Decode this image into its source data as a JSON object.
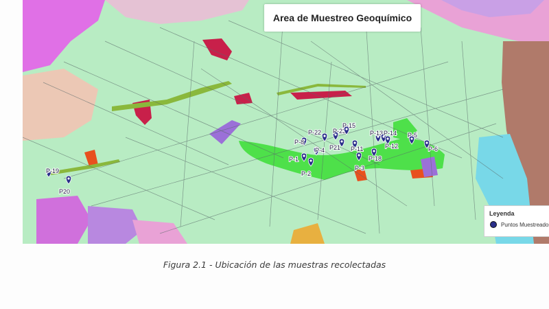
{
  "map": {
    "title": "Area de Muestreo Geoquímico",
    "legend": {
      "title": "Leyenda",
      "items": [
        {
          "label": "Puntos Muestreados",
          "color": "#2a2f8a"
        }
      ]
    },
    "samples": [
      {
        "id": "P-19"
      },
      {
        "id": "P20"
      },
      {
        "id": "P-1"
      },
      {
        "id": "P-2"
      },
      {
        "id": "P-4"
      },
      {
        "id": "P-8"
      },
      {
        "id": "P-22"
      },
      {
        "id": "P-23"
      },
      {
        "id": "P-15"
      },
      {
        "id": "P21"
      },
      {
        "id": "P-11"
      },
      {
        "id": "P-13"
      },
      {
        "id": "P-14"
      },
      {
        "id": "P-3"
      },
      {
        "id": "P-18"
      },
      {
        "id": "P-12"
      },
      {
        "id": "P-5"
      },
      {
        "id": "P-6"
      }
    ],
    "colors": {
      "base": "#b8ecc3",
      "magenta": "#e070e6",
      "bright_green": "#4ee04a",
      "crimson": "#c8204a",
      "orange": "#e8501e",
      "purple": "#9b70d8",
      "cyan": "#78d8e8",
      "brown": "#b07a6a"
    }
  },
  "caption": "Figura 2.1 - Ubicación de las muestras recolectadas"
}
